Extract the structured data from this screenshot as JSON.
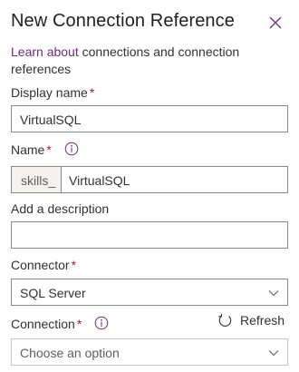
{
  "panel": {
    "title": "New Connection Reference",
    "intro_link": "Learn about",
    "intro_text": " connections and connection references"
  },
  "form": {
    "display_name_label": "Display name",
    "display_name_value": "VirtualSQL",
    "name_label": "Name",
    "name_prefix": "skills_",
    "name_value": "VirtualSQL",
    "description_label": "Add a description",
    "description_value": "",
    "connector_label": "Connector",
    "connector_value": "SQL Server",
    "connection_label": "Connection",
    "connection_placeholder": "Choose an option",
    "refresh_label": "Refresh",
    "required_mark": "*"
  },
  "icons": {
    "close": "close-icon",
    "info": "info-icon",
    "chevron": "chevron-down-icon",
    "refresh": "refresh-icon"
  },
  "colors": {
    "link": "#742774",
    "required": "#a4262c",
    "border": "#8a8886",
    "prefix_bg": "#f3f2f1"
  }
}
